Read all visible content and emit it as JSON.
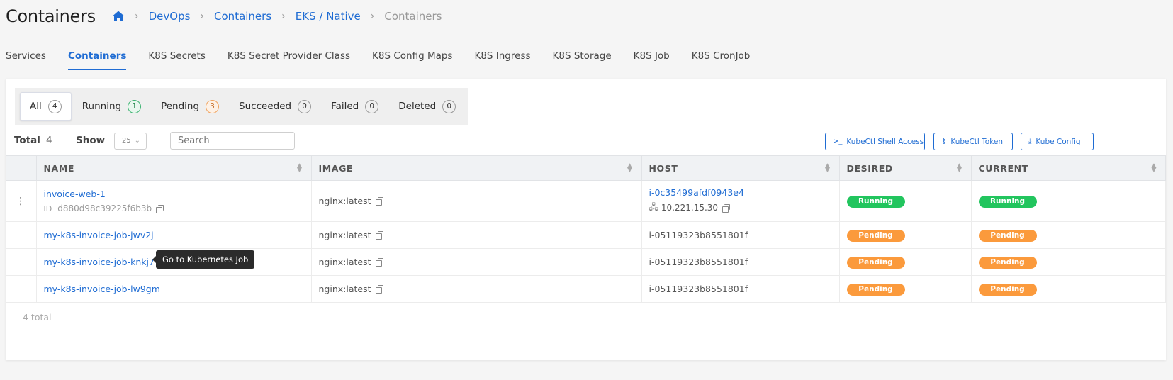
{
  "page": {
    "title": "Containers"
  },
  "breadcrumb": {
    "items": [
      "DevOps",
      "Containers",
      "EKS / Native"
    ],
    "current": "Containers"
  },
  "tabs": [
    {
      "label": "Services"
    },
    {
      "label": "Containers",
      "active": true
    },
    {
      "label": "K8S Secrets"
    },
    {
      "label": "K8S Secret Provider Class"
    },
    {
      "label": "K8S Config Maps"
    },
    {
      "label": "K8S Ingress"
    },
    {
      "label": "K8S Storage"
    },
    {
      "label": "K8S Job"
    },
    {
      "label": "K8S CronJob"
    }
  ],
  "filters": [
    {
      "label": "All",
      "count": "4",
      "active": true
    },
    {
      "label": "Running",
      "count": "1",
      "color": "green"
    },
    {
      "label": "Pending",
      "count": "3",
      "color": "orange"
    },
    {
      "label": "Succeeded",
      "count": "0"
    },
    {
      "label": "Failed",
      "count": "0"
    },
    {
      "label": "Deleted",
      "count": "0"
    }
  ],
  "toolbar": {
    "total_label": "Total",
    "total_value": "4",
    "show_label": "Show",
    "show_value": "25",
    "search_placeholder": "Search",
    "buttons": {
      "shell": "KubeCtl Shell Access",
      "token": "KubeCtl Token",
      "config": "Kube Config"
    }
  },
  "table": {
    "headers": {
      "name": "NAME",
      "image": "IMAGE",
      "host": "HOST",
      "desired": "DESIRED",
      "current": "CURRENT"
    },
    "rows": [
      {
        "name": "invoice-web-1",
        "id": "d880d98c39225f6b3b",
        "image": "nginx:latest",
        "host": "i-0c35499afdf0943e4",
        "ip": "10.221.15.30",
        "desired": "Running",
        "current": "Running"
      },
      {
        "name": "my-k8s-invoice-job-jwv2j",
        "image": "nginx:latest",
        "host": "i-05119323b8551801f",
        "desired": "Pending",
        "current": "Pending"
      },
      {
        "name": "my-k8s-invoice-job-knkj7",
        "image": "nginx:latest",
        "host": "i-05119323b8551801f",
        "desired": "Pending",
        "current": "Pending"
      },
      {
        "name": "my-k8s-invoice-job-lw9gm",
        "image": "nginx:latest",
        "host": "i-05119323b8551801f",
        "desired": "Pending",
        "current": "Pending"
      }
    ],
    "footer": "4 total"
  },
  "tooltip": {
    "text": "Go to Kubernetes Job"
  },
  "colors": {
    "accent": "#1f6cd3",
    "running": "#22c55e",
    "pending": "#fb9a3c"
  }
}
